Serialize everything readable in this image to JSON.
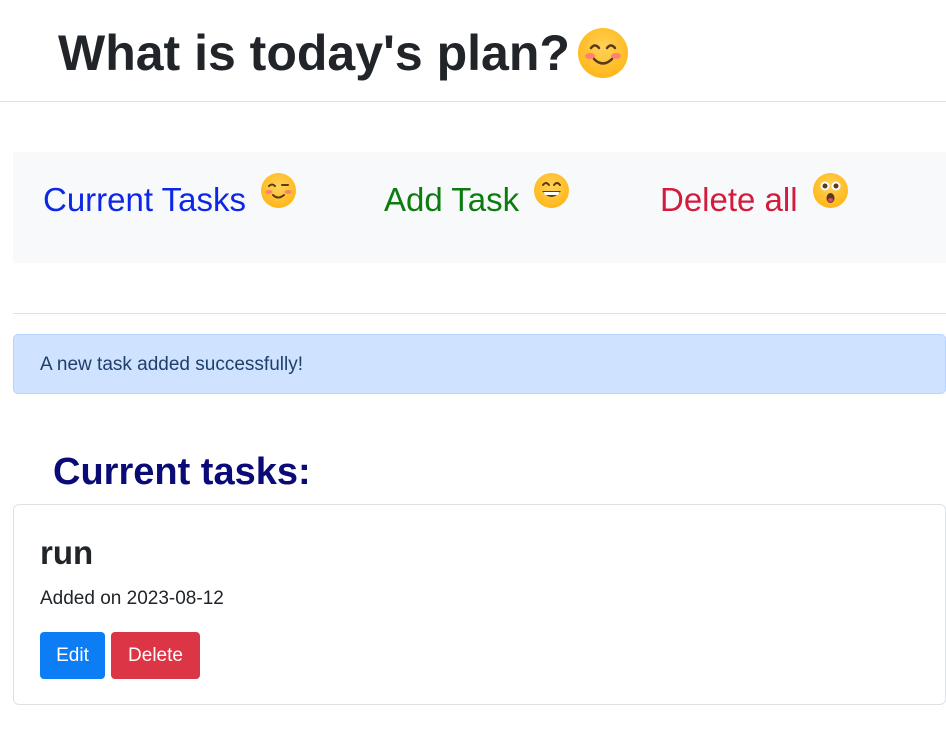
{
  "header": {
    "title": "What is today's plan?",
    "emoji": "smiling-face-with-blush-icon"
  },
  "nav": {
    "items": [
      {
        "label": "Current Tasks",
        "icon": "winking-face-icon",
        "color": "#0d27e6"
      },
      {
        "label": "Add Task",
        "icon": "grinning-face-icon",
        "color": "#0c7c10"
      },
      {
        "label": "Delete all",
        "icon": "astonished-face-icon",
        "color": "#d31b3e"
      }
    ]
  },
  "alert": {
    "message": "A new task added successfully!",
    "color": "#cfe2ff"
  },
  "tasks_section": {
    "title": "Current tasks:",
    "color": "#0b0b78"
  },
  "tasks": [
    {
      "title": "run",
      "added": "Added on 2023-08-12",
      "edit_label": "Edit",
      "delete_label": "Delete"
    }
  ],
  "colors": {
    "edit_button": "#0d7df5",
    "delete_button": "#dc3545"
  }
}
